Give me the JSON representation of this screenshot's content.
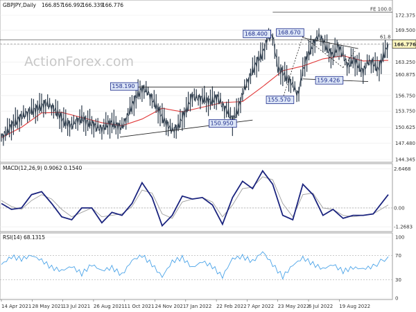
{
  "watermark": "ActionForex.com",
  "chart_data": [
    {
      "type": "candlestick",
      "title": "GBPJPY,Daily",
      "ohlc": {
        "open": "166.857",
        "high": "166.992",
        "low": "166.339",
        "close": "166.776"
      },
      "ylim": [
        144.345,
        174.8
      ],
      "yticks": [
        "172.375",
        "169.500",
        "166.625",
        "163.250",
        "160.875",
        "156.750",
        "153.750",
        "150.625",
        "147.480",
        "144.345"
      ],
      "last_price": "166.776",
      "fib_labels": [
        {
          "text": "FE 100.0",
          "y": 173.0
        },
        {
          "text": "61.8",
          "y": 167.6
        }
      ],
      "price_labels": [
        "168.400",
        "168.670",
        "158.190",
        "155.570",
        "150.950",
        "159.426"
      ],
      "series": [
        {
          "name": "price",
          "x": [
            0,
            5,
            10,
            15,
            20,
            25,
            30,
            35,
            40,
            45,
            50,
            55,
            60,
            65,
            70,
            75,
            80,
            85,
            90,
            95,
            100,
            105,
            110,
            115,
            120,
            125,
            130,
            135,
            140,
            145,
            150,
            155,
            160,
            165,
            170,
            175,
            180,
            185,
            190,
            195,
            200,
            205,
            210,
            215,
            220,
            225,
            230,
            235,
            240,
            245,
            250,
            255,
            260,
            265,
            270,
            275,
            280,
            285,
            290,
            295,
            300,
            305,
            310,
            315,
            320,
            325,
            330,
            335,
            340,
            345,
            350,
            355,
            360,
            365,
            370,
            375,
            380,
            385
          ],
          "values": [
            148.6,
            149.6,
            150.9,
            151.8,
            152.6,
            153.3,
            153.8,
            154.1,
            154.8,
            155.2,
            154.6,
            153.6,
            152.3,
            151.3,
            150.9,
            151.9,
            152.3,
            151.6,
            151.3,
            150.6,
            150.3,
            151.1,
            151.4,
            150.9,
            150.6,
            152.6,
            154.8,
            156.9,
            158.0,
            157.6,
            156.1,
            154.4,
            152.6,
            151.1,
            150.0,
            150.5,
            152.4,
            154.4,
            156.8,
            156.2,
            156.3,
            155.6,
            155.8,
            156.5,
            154.8,
            153.8,
            151.8,
            153.8,
            157.1,
            159.5,
            161.6,
            163.5,
            164.9,
            168.0,
            168.4,
            162.1,
            161.2,
            160.0,
            158.8,
            156.8,
            161.6,
            164.8,
            166.5,
            168.4,
            167.4,
            165.6,
            164.5,
            166.4,
            164.6,
            162.4,
            163.9,
            162.6,
            161.4,
            163.4,
            163.1,
            161.8,
            164.4,
            166.8
          ]
        },
        {
          "name": "MA",
          "x": [
            0,
            20,
            40,
            60,
            80,
            100,
            120,
            140,
            160,
            180,
            200,
            220,
            240,
            260,
            280,
            300,
            320,
            340,
            360,
            385
          ],
          "values": [
            148.6,
            150.6,
            153.4,
            153.5,
            152.5,
            151.5,
            150.9,
            152.2,
            154.3,
            153.6,
            154.5,
            155.4,
            155.6,
            158.5,
            161.6,
            162.5,
            163.9,
            164.5,
            163.5,
            163.6
          ]
        }
      ]
    },
    {
      "type": "line",
      "title": "MACD(12,26,9) 0.9062 0.1540",
      "ylim": [
        -1.5,
        2.8
      ],
      "yticks": [
        "2.6468",
        "0.00",
        "-1.2683"
      ],
      "series": [
        {
          "name": "MACD",
          "x": [
            0,
            10,
            20,
            30,
            40,
            50,
            60,
            70,
            80,
            90,
            100,
            110,
            120,
            130,
            140,
            150,
            160,
            170,
            180,
            190,
            200,
            210,
            220,
            230,
            240,
            250,
            260,
            270,
            280,
            290,
            300,
            310,
            320,
            330,
            340,
            350,
            360,
            370,
            385
          ],
          "values": [
            0.3,
            -0.1,
            0.0,
            0.9,
            1.1,
            0.3,
            -0.6,
            -0.8,
            0.0,
            0.0,
            -1.0,
            -0.3,
            -0.5,
            0.3,
            1.7,
            0.7,
            -1.2,
            -0.5,
            0.8,
            0.6,
            0.7,
            0.2,
            -1.1,
            0.7,
            1.8,
            1.3,
            2.5,
            1.6,
            -0.5,
            -0.8,
            1.6,
            0.9,
            -0.5,
            -0.1,
            -0.7,
            -0.5,
            -0.5,
            -0.4,
            0.9
          ]
        },
        {
          "name": "Signal",
          "x": [
            0,
            10,
            20,
            30,
            40,
            50,
            60,
            70,
            80,
            90,
            100,
            110,
            120,
            130,
            140,
            150,
            160,
            170,
            180,
            190,
            200,
            210,
            220,
            230,
            240,
            250,
            260,
            270,
            280,
            290,
            300,
            310,
            320,
            330,
            340,
            350,
            360,
            370,
            385
          ],
          "values": [
            0.5,
            0.1,
            -0.1,
            0.5,
            0.9,
            0.6,
            -0.1,
            -0.6,
            -0.3,
            0.0,
            -0.6,
            -0.5,
            -0.4,
            0.1,
            1.2,
            1.0,
            -0.4,
            -0.7,
            0.4,
            0.6,
            0.7,
            0.4,
            -0.6,
            0.2,
            1.3,
            1.4,
            2.1,
            1.9,
            0.3,
            -0.6,
            0.9,
            1.0,
            0.0,
            -0.1,
            -0.5,
            -0.6,
            -0.5,
            -0.4,
            0.2
          ]
        }
      ]
    },
    {
      "type": "line",
      "title": "RSI(14) 68.1315",
      "ylim": [
        0,
        100
      ],
      "yticks": [
        "100",
        "70",
        "30",
        "0"
      ],
      "series": [
        {
          "name": "RSI",
          "x": [
            0,
            10,
            20,
            30,
            40,
            50,
            60,
            70,
            80,
            90,
            100,
            110,
            120,
            130,
            140,
            150,
            160,
            170,
            180,
            190,
            200,
            210,
            220,
            230,
            240,
            250,
            260,
            270,
            280,
            290,
            300,
            310,
            320,
            330,
            340,
            350,
            360,
            370,
            385
          ],
          "values": [
            55,
            68,
            64,
            70,
            62,
            50,
            45,
            52,
            40,
            55,
            45,
            50,
            38,
            62,
            70,
            55,
            35,
            60,
            66,
            50,
            60,
            52,
            35,
            65,
            68,
            60,
            76,
            55,
            35,
            54,
            66,
            56,
            48,
            55,
            44,
            50,
            48,
            52,
            68
          ]
        }
      ]
    }
  ],
  "xaxis": {
    "ticks": [
      "14 Apr 2021",
      "28 May 2021",
      "13 Jul 2021",
      "26 Aug 2021",
      "11 Oct 2021",
      "24 Nov 2021",
      "7 Jan 2022",
      "22 Feb 2022",
      "7 Apr 2022",
      "23 May 2022",
      "6 Jul 2022",
      "19 Aug 2022"
    ]
  },
  "colors": {
    "price": "#2b3a4a",
    "ma": "#e23a3a",
    "macd": "#1a237e",
    "signal": "#9e9e9e",
    "rsi": "#4aa3e8",
    "label_bg": "#dde6f7",
    "label_border": "#1a2a8a",
    "last_bg": "#fff8c0",
    "grid": "#e9e9e9"
  }
}
